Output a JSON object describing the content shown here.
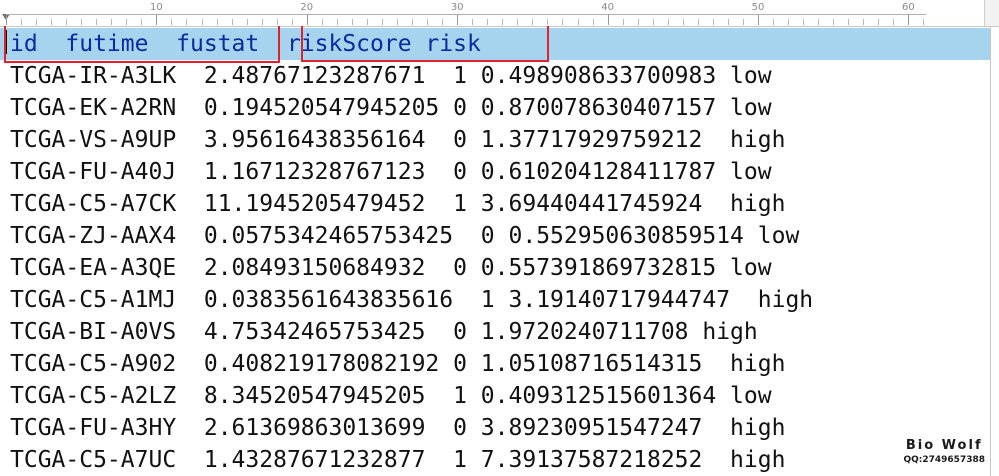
{
  "ruler": {
    "labels": [
      "10",
      "20",
      "30",
      "40",
      "50",
      "60"
    ]
  },
  "header": {
    "text": "id  futime  fustat  riskScore risk"
  },
  "rows": [
    "TCGA-IR-A3LK  2.48767123287671  1 0.498908633700983 low",
    "TCGA-EK-A2RN  0.194520547945205 0 0.870078630407157 low",
    "TCGA-VS-A9UP  3.95616438356164  0 1.37717929759212  high",
    "TCGA-FU-A40J  1.16712328767123  0 0.610204128411787 low",
    "TCGA-C5-A7CK  11.1945205479452  1 3.69440441745924  high",
    "TCGA-ZJ-AAX4  0.0575342465753425  0 0.552950630859514 low",
    "TCGA-EA-A3QE  2.08493150684932  0 0.557391869732815 low",
    "TCGA-C5-A1MJ  0.0383561643835616  1 3.19140717944747  high",
    "TCGA-BI-A0VS  4.75342465753425  0 1.9720240711708 high",
    "TCGA-C5-A902  0.408219178082192 0 1.05108716514315  high",
    "TCGA-C5-A2LZ  8.34520547945205  1 0.409312515601364 low",
    "TCGA-FU-A3HY  2.61369863013699  0 3.89230951547247  high",
    "TCGA-C5-A7UC  1.43287671232877  1 7.39137587218252  high"
  ],
  "watermark": {
    "title": "Bio Wolf",
    "subtitle": "QQ:2749657388"
  },
  "colors": {
    "header_bg": "#a6d4ef",
    "header_text": "#0a2a9e",
    "highlight_box": "#e0232a"
  }
}
